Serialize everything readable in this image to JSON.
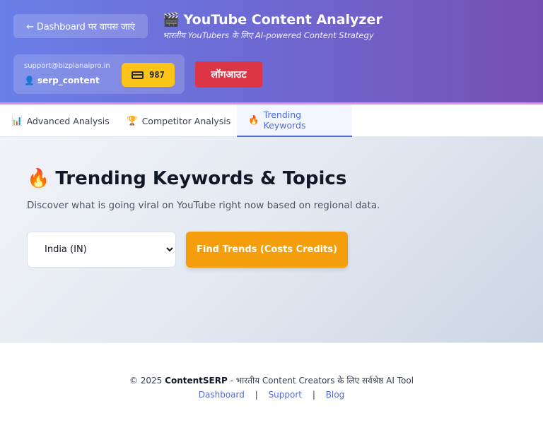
{
  "header": {
    "back_label": "← Dashboard पर वापस जाएं",
    "title_icon": "🎬",
    "title": "YouTube Content Analyzer",
    "subtitle": "भारतीय YouTubers के लिए AI-powered Content Strategy",
    "user": {
      "email": "support@bizplanaipro.in",
      "person_icon": "👤",
      "username": "serp_content",
      "credits": "987"
    },
    "logout_label": "लॉगआउट"
  },
  "tabs": [
    {
      "icon": "📊",
      "label": "Advanced Analysis"
    },
    {
      "icon": "🏆",
      "label": "Competitor Analysis"
    },
    {
      "icon": "🔥",
      "label": "Trending Keywords",
      "active": true
    }
  ],
  "main": {
    "title_icon": "🔥",
    "title": "Trending Keywords & Topics",
    "description": "Discover what is going viral on YouTube right now based on regional data.",
    "region_selected": "India (IN)",
    "find_button": "Find Trends (Costs Credits)"
  },
  "footer": {
    "copyright": "© 2025",
    "brand": "ContentSERP",
    "tagline": "- भारतीय Content Creators के लिए सर्वश्रेष्ठ AI Tool",
    "links": [
      "Dashboard",
      "Support",
      "Blog"
    ],
    "separator": "|"
  },
  "colors": {
    "header_gradient_start": "#6a7fe8",
    "header_gradient_end": "#7650b0",
    "credits_badge": "#fcc419",
    "logout": "#dc3545",
    "find_button": "#f59e0b",
    "active_tab": "#4f6bd8"
  }
}
